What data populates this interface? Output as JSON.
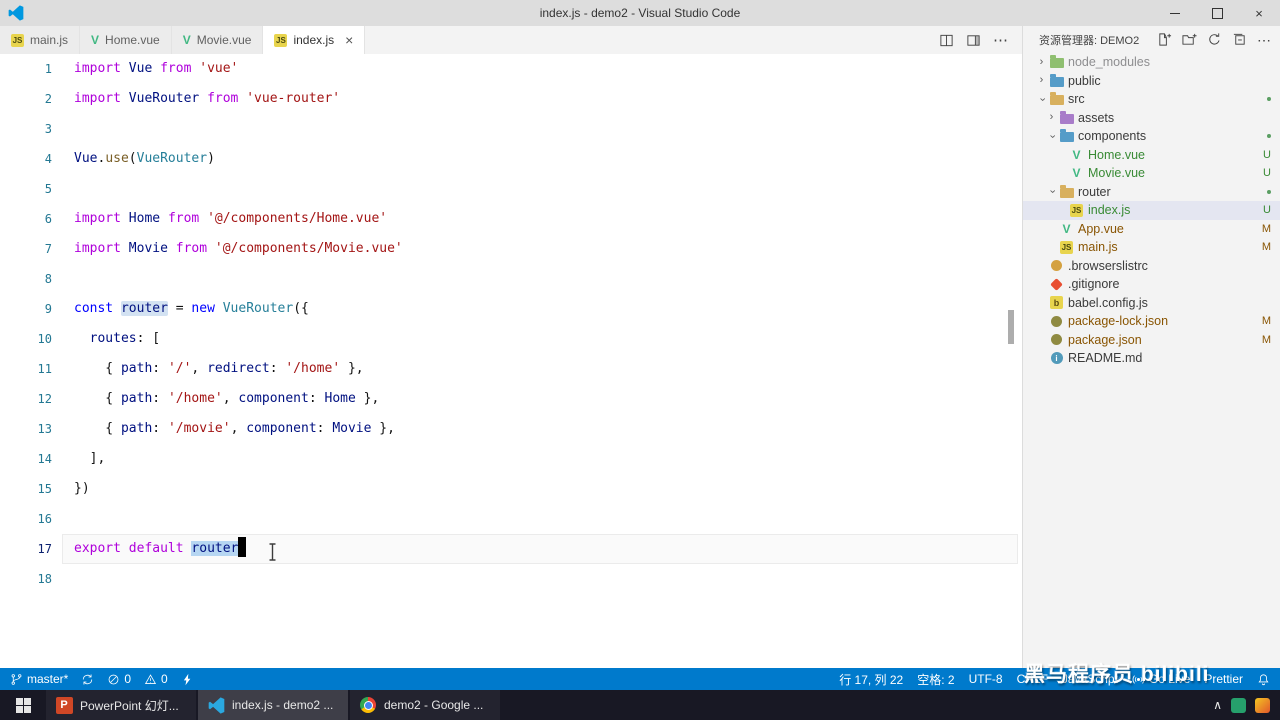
{
  "titlebar": {
    "title": "index.js - demo2 - Visual Studio Code"
  },
  "tabs": [
    {
      "label": "main.js",
      "icon": "js",
      "active": false
    },
    {
      "label": "Home.vue",
      "icon": "vue",
      "active": false
    },
    {
      "label": "Movie.vue",
      "icon": "vue",
      "active": false
    },
    {
      "label": "index.js",
      "icon": "js",
      "active": true
    }
  ],
  "editor_actions": [
    {
      "name": "split-editor-button",
      "icon": "split"
    },
    {
      "name": "editor-layout-button",
      "icon": "layout"
    },
    {
      "name": "editor-more-button",
      "icon": "more"
    }
  ],
  "editor": {
    "lines": [
      {
        "n": 1,
        "t": [
          [
            "import ",
            "kp"
          ],
          [
            "Vue ",
            "var"
          ],
          [
            "from ",
            "kp"
          ],
          [
            "'vue'",
            "str"
          ]
        ]
      },
      {
        "n": 2,
        "t": [
          [
            "import ",
            "kp"
          ],
          [
            "VueRouter ",
            "var"
          ],
          [
            "from ",
            "kp"
          ],
          [
            "'vue-router'",
            "str"
          ]
        ]
      },
      {
        "n": 3,
        "t": []
      },
      {
        "n": 4,
        "t": [
          [
            "Vue",
            "var"
          ],
          [
            ".",
            "pun"
          ],
          [
            "use",
            "fn"
          ],
          [
            "(",
            "pun"
          ],
          [
            "VueRouter",
            "typ"
          ],
          [
            ")",
            "pun"
          ]
        ]
      },
      {
        "n": 5,
        "t": []
      },
      {
        "n": 6,
        "t": [
          [
            "import ",
            "kp"
          ],
          [
            "Home ",
            "var"
          ],
          [
            "from ",
            "kp"
          ],
          [
            "'@/components/Home.vue'",
            "str"
          ]
        ]
      },
      {
        "n": 7,
        "t": [
          [
            "import ",
            "kp"
          ],
          [
            "Movie ",
            "var"
          ],
          [
            "from ",
            "kp"
          ],
          [
            "'@/components/Movie.vue'",
            "str"
          ]
        ]
      },
      {
        "n": 8,
        "t": []
      },
      {
        "n": 9,
        "t": [
          [
            "const ",
            "kb"
          ],
          [
            "router",
            "var hlw"
          ],
          [
            " = ",
            "pun"
          ],
          [
            "new ",
            "kb"
          ],
          [
            "VueRouter",
            "typ"
          ],
          [
            "({",
            "pun"
          ]
        ]
      },
      {
        "n": 10,
        "t": [
          [
            "  ",
            "pun"
          ],
          [
            "routes",
            "var"
          ],
          [
            ": [",
            "pun"
          ]
        ]
      },
      {
        "n": 11,
        "t": [
          [
            "    { ",
            "pun"
          ],
          [
            "path",
            "var"
          ],
          [
            ": ",
            "pun"
          ],
          [
            "'/'",
            "str"
          ],
          [
            ", ",
            "pun"
          ],
          [
            "redirect",
            "var"
          ],
          [
            ": ",
            "pun"
          ],
          [
            "'/home'",
            "str"
          ],
          [
            " },",
            "pun"
          ]
        ]
      },
      {
        "n": 12,
        "t": [
          [
            "    { ",
            "pun"
          ],
          [
            "path",
            "var"
          ],
          [
            ": ",
            "pun"
          ],
          [
            "'/home'",
            "str"
          ],
          [
            ", ",
            "pun"
          ],
          [
            "component",
            "var"
          ],
          [
            ": ",
            "pun"
          ],
          [
            "Home",
            "var"
          ],
          [
            " },",
            "pun"
          ]
        ]
      },
      {
        "n": 13,
        "t": [
          [
            "    { ",
            "pun"
          ],
          [
            "path",
            "var"
          ],
          [
            ": ",
            "pun"
          ],
          [
            "'/movie'",
            "str"
          ],
          [
            ", ",
            "pun"
          ],
          [
            "component",
            "var"
          ],
          [
            ": ",
            "pun"
          ],
          [
            "Movie",
            "var"
          ],
          [
            " },",
            "pun"
          ]
        ]
      },
      {
        "n": 14,
        "t": [
          [
            "  ],",
            "pun"
          ]
        ]
      },
      {
        "n": 15,
        "t": [
          [
            "})",
            "pun"
          ]
        ]
      },
      {
        "n": 16,
        "t": []
      },
      {
        "n": 17,
        "t": [
          [
            "export ",
            "kp"
          ],
          [
            "default ",
            "kp"
          ],
          [
            "router",
            "var sel"
          ]
        ],
        "cur": true,
        "cursor": true
      },
      {
        "n": 18,
        "t": []
      }
    ]
  },
  "explorer": {
    "title": "资源管理器: DEMO2",
    "actions": [
      {
        "name": "new-file-button",
        "icon": "new-file"
      },
      {
        "name": "new-folder-button",
        "icon": "new-folder"
      },
      {
        "name": "refresh-explorer-button",
        "icon": "refresh"
      },
      {
        "name": "collapse-folders-button",
        "icon": "collapse-all"
      },
      {
        "name": "views-more-button",
        "icon": "more"
      }
    ],
    "items": [
      {
        "indent": 0,
        "chevron": "collapsed",
        "icon": "folder",
        "color": "#8fbf70",
        "label": "node_modules",
        "status": "ignored"
      },
      {
        "indent": 0,
        "chevron": "collapsed",
        "icon": "folder",
        "color": "#559cc8",
        "label": "public"
      },
      {
        "indent": 0,
        "chevron": "expanded",
        "icon": "folder",
        "color": "#d8b05e",
        "label": "src",
        "dot": true
      },
      {
        "indent": 1,
        "chevron": "collapsed",
        "icon": "folder",
        "color": "#a87cc9",
        "label": "assets"
      },
      {
        "indent": 1,
        "chevron": "expanded",
        "icon": "folder",
        "color": "#559cc8",
        "label": "components",
        "dot": true
      },
      {
        "indent": 2,
        "icon": "vue",
        "label": "Home.vue",
        "badge": "U",
        "status": "untracked"
      },
      {
        "indent": 2,
        "icon": "vue",
        "label": "Movie.vue",
        "badge": "U",
        "status": "untracked"
      },
      {
        "indent": 1,
        "chevron": "expanded",
        "icon": "folder",
        "color": "#d8b05e",
        "label": "router",
        "dot": true
      },
      {
        "indent": 2,
        "icon": "js",
        "label": "index.js",
        "badge": "U",
        "status": "untracked",
        "selected": true
      },
      {
        "indent": 1,
        "icon": "vue",
        "label": "App.vue",
        "badge": "M",
        "status": "modified"
      },
      {
        "indent": 1,
        "icon": "js",
        "label": "main.js",
        "badge": "M",
        "status": "modified"
      },
      {
        "indent": 0,
        "icon": "list",
        "label": ".browserslistrc"
      },
      {
        "indent": 0,
        "icon": "git",
        "label": ".gitignore"
      },
      {
        "indent": 0,
        "icon": "babel",
        "label": "babel.config.js"
      },
      {
        "indent": 0,
        "icon": "npm",
        "label": "package-lock.json",
        "badge": "M",
        "status": "modified"
      },
      {
        "indent": 0,
        "icon": "npm",
        "label": "package.json",
        "badge": "M",
        "status": "modified"
      },
      {
        "indent": 0,
        "icon": "md",
        "label": "README.md"
      }
    ]
  },
  "statusbar": {
    "left": [
      {
        "name": "git-branch",
        "icon": "branch",
        "label": "master*"
      },
      {
        "name": "sync-changes",
        "icon": "sync",
        "label": ""
      },
      {
        "name": "errors",
        "icon": "error",
        "label": "0"
      },
      {
        "name": "warnings",
        "icon": "warning",
        "label": "0"
      },
      {
        "name": "live-share",
        "icon": "bolt",
        "label": ""
      }
    ],
    "right": [
      {
        "name": "cursor-position",
        "label": "行 17, 列 22"
      },
      {
        "name": "indentation",
        "label": "空格: 2"
      },
      {
        "name": "encoding",
        "label": "UTF-8"
      },
      {
        "name": "eol",
        "label": "CRLF"
      },
      {
        "name": "language-mode",
        "label": "JavaScript"
      },
      {
        "name": "go-live",
        "icon": "broadcast",
        "label": "Go Live"
      },
      {
        "name": "prettier",
        "label": "Prettier"
      },
      {
        "name": "notifications",
        "icon": "bell",
        "label": ""
      }
    ]
  },
  "taskbar": {
    "apps": [
      {
        "name": "taskbar-powerpoint",
        "icon": "ppt",
        "label": "PowerPoint 幻灯...",
        "active": false
      },
      {
        "name": "taskbar-vscode",
        "icon": "vscode",
        "label": "index.js - demo2 ...",
        "active": true
      },
      {
        "name": "taskbar-chrome",
        "icon": "chrome",
        "label": "demo2 - Google ...",
        "active": false
      }
    ],
    "tray": [
      {
        "name": "tray-expand",
        "label": "∧"
      },
      {
        "name": "tray-app-green",
        "icon": "square-green"
      },
      {
        "name": "tray-ime",
        "icon": "square-color"
      }
    ]
  },
  "watermark": {
    "text": "黑马程序员 bilibili"
  },
  "colors": {
    "statusbar": "#007acc",
    "untracked": "#388a34",
    "modified": "#895503",
    "vue_green": "#41b883",
    "js_yellow": "#e8d44d",
    "selection": "#add6ff"
  }
}
